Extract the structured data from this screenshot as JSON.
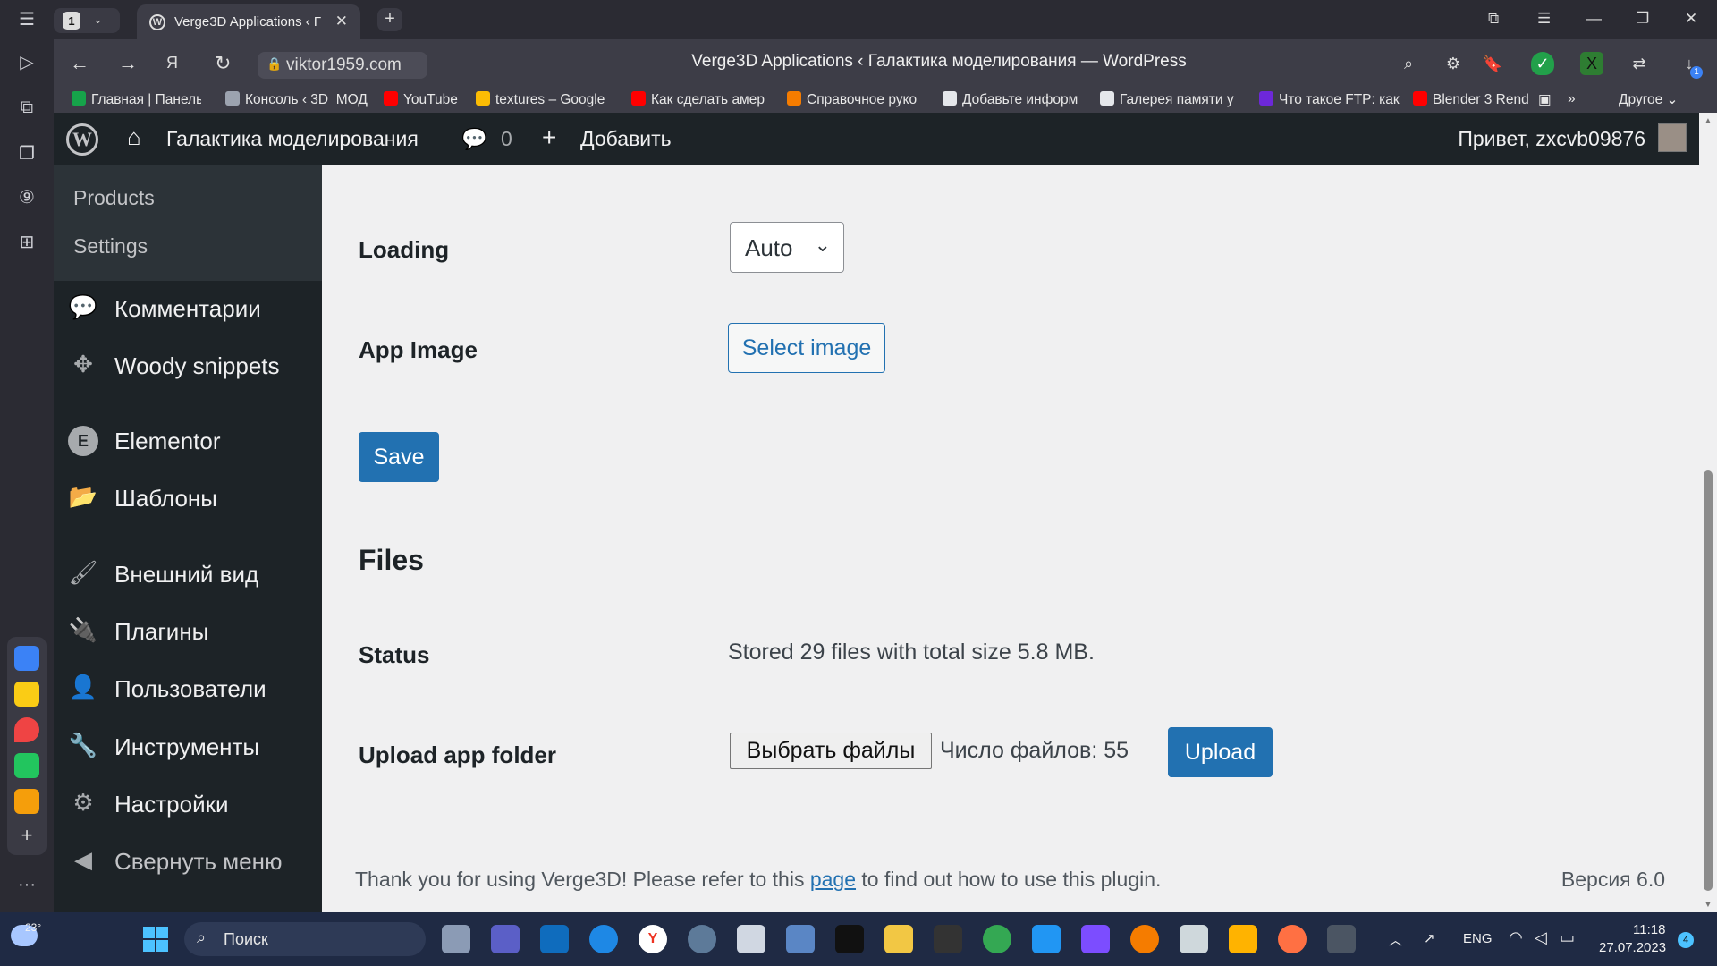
{
  "browser": {
    "tab_count": "1",
    "active_tab_title": "Verge3D Applications ‹ Г",
    "url": "viktor1959.com",
    "page_title": "Verge3D Applications ‹ Галактика моделирования — WordPress",
    "bookmarks": [
      "Главная | Панель",
      "Консоль ‹ 3D_МОД",
      "YouTube",
      "textures – Google",
      "Как сделать амер",
      "Справочное руко",
      "Добавьте информ",
      "Галерея памяти у",
      "Что такое FTP: как",
      "Blender 3 Rende"
    ],
    "bookmarks_other": "Другое",
    "download_badge": "1"
  },
  "admin_bar": {
    "site_name": "Галактика моделирования",
    "comments_count": "0",
    "add_new": "Добавить",
    "greeting": "Привет, zxcvb09876"
  },
  "sidebar": {
    "submenu": [
      "Products",
      "Settings"
    ],
    "items": [
      {
        "label": "Комментарии",
        "icon": "comment-icon"
      },
      {
        "label": "Woody snippets",
        "icon": "snippet-icon"
      },
      {
        "label": "Elementor",
        "icon": "elementor-icon"
      },
      {
        "label": "Шаблоны",
        "icon": "folder-icon"
      },
      {
        "label": "Внешний вид",
        "icon": "brush-icon"
      },
      {
        "label": "Плагины",
        "icon": "plug-icon"
      },
      {
        "label": "Пользователи",
        "icon": "user-icon"
      },
      {
        "label": "Инструменты",
        "icon": "wrench-icon"
      },
      {
        "label": "Настройки",
        "icon": "settings-icon"
      }
    ],
    "collapse": "Свернуть меню"
  },
  "form": {
    "loading_label": "Loading",
    "loading_value": "Auto",
    "app_image_label": "App Image",
    "select_image": "Select image",
    "save": "Save"
  },
  "files": {
    "title": "Files",
    "status_label": "Status",
    "status_value": "Stored 29 files with total size 5.8 MB.",
    "upload_label": "Upload app folder",
    "choose_files": "Выбрать файлы",
    "file_count": "Число файлов: 55",
    "upload": "Upload"
  },
  "footer": {
    "text_before": "Thank you for using Verge3D! Please refer to this",
    "link": "page",
    "text_after": "to find out how to use this plugin.",
    "version": "Версия 6.0"
  },
  "taskbar": {
    "weather": "23°",
    "search_placeholder": "Поиск",
    "language": "ENG",
    "time": "11:18",
    "date": "27.07.2023",
    "notifications": "4"
  },
  "colors": {
    "wp_primary": "#2271b1",
    "wp_dark": "#1d2327",
    "content_bg": "#f0f0f1"
  }
}
